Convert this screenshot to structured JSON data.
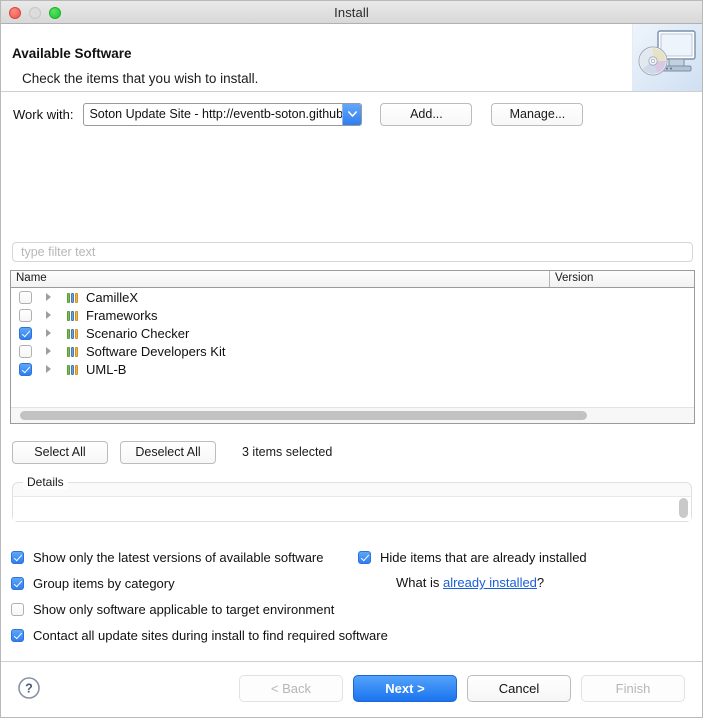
{
  "window": {
    "title": "Install",
    "traffic_lights": [
      "close",
      "minimize",
      "zoom"
    ]
  },
  "banner": {
    "title": "Available Software",
    "subtitle": "Check the items that you wish to install.",
    "art_icon": "monitor-with-disc-icon"
  },
  "work_with": {
    "label": "Work with:",
    "value": "Soton Update Site - http://eventb-soton.github.io/updateS",
    "arrow_icon": "chevron-down-icon",
    "add_label": "Add...",
    "manage_label": "Manage..."
  },
  "filter": {
    "placeholder": "type filter text",
    "value": ""
  },
  "tree": {
    "columns": [
      "Name",
      "Version"
    ],
    "rows": [
      {
        "name": "CamilleX",
        "version": "",
        "checked": false,
        "expandable": true,
        "icon": "category-icon"
      },
      {
        "name": "Frameworks",
        "version": "",
        "checked": false,
        "expandable": true,
        "icon": "category-icon"
      },
      {
        "name": "Scenario Checker",
        "version": "",
        "checked": true,
        "expandable": true,
        "icon": "category-icon"
      },
      {
        "name": "Software Developers Kit",
        "version": "",
        "checked": false,
        "expandable": true,
        "icon": "category-icon"
      },
      {
        "name": "UML-B",
        "version": "",
        "checked": true,
        "expandable": true,
        "icon": "category-icon"
      }
    ]
  },
  "selection_bar": {
    "select_all_label": "Select All",
    "deselect_all_label": "Deselect All",
    "count_text": "3 items selected"
  },
  "details": {
    "legend": "Details",
    "text": ""
  },
  "options": {
    "show_latest": {
      "label": "Show only the latest versions of available software",
      "checked": true
    },
    "group_by_category": {
      "label": "Group items by category",
      "checked": true
    },
    "show_applicable": {
      "label": "Show only software applicable to target environment",
      "checked": false
    },
    "contact_all_sites": {
      "label": "Contact all update sites during install to find required software",
      "checked": true
    },
    "hide_installed": {
      "label": "Hide items that are already installed",
      "checked": true
    },
    "what_is_prefix": "What is ",
    "what_is_link": "already installed",
    "what_is_suffix": "?"
  },
  "footer": {
    "help_icon": "help-question-icon",
    "back_label": "< Back",
    "next_label": "Next >",
    "cancel_label": "Cancel",
    "finish_label": "Finish"
  },
  "colors": {
    "accent_blue": "#2f7ef0",
    "link_blue": "#1a5ed8",
    "close_red": "#f0534a",
    "zoom_green": "#15c72c"
  }
}
